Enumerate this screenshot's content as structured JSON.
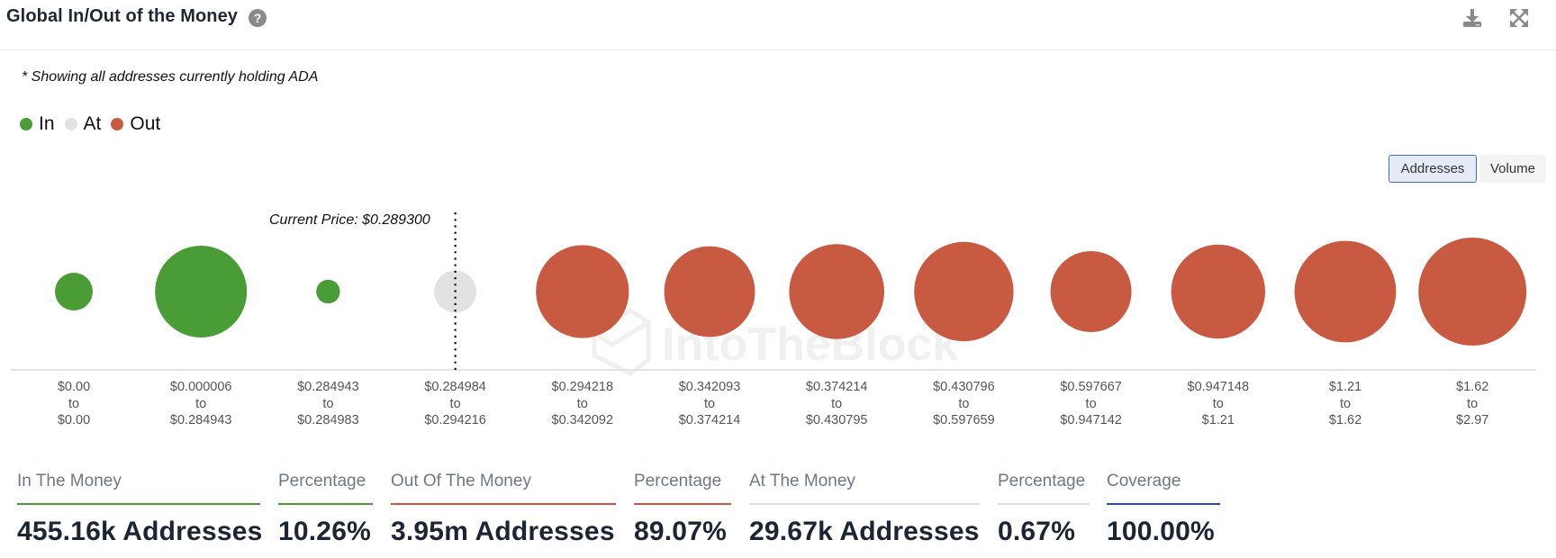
{
  "header": {
    "title": "Global In/Out of the Money",
    "help_icon": "question-circle-icon",
    "download_icon": "download-icon",
    "expand_icon": "expand-arrows-icon"
  },
  "note": "* Showing all addresses currently holding ADA",
  "legend": [
    {
      "label": "In",
      "color": "#4a9c37"
    },
    {
      "label": "At",
      "color": "#e2e2e2"
    },
    {
      "label": "Out",
      "color": "#c95a42"
    }
  ],
  "toggle": {
    "addresses_label": "Addresses",
    "volume_label": "Volume",
    "selected": "Addresses"
  },
  "colors": {
    "in": "#4a9c37",
    "at": "#e2e2e2",
    "out": "#c95a42",
    "coverage": "#2a46d6",
    "at_line": "#dcdcdc",
    "baseline": "#dde3ef"
  },
  "chart_data": {
    "type": "bubble",
    "title": "Global In/Out of the Money",
    "current_price_label": "Current Price: $0.289300",
    "current_price": 0.2893,
    "current_price_bucket_index": 3,
    "watermark": "IntoTheBlock",
    "size_metric": "Addresses",
    "size_note": "relative bubble size (estimated from bubble diameter, largest = 1.0)",
    "buckets": [
      {
        "from": "$0.00",
        "to": "$0.00",
        "status": "in",
        "relative_size": 0.35
      },
      {
        "from": "$0.000006",
        "to": "$0.284943",
        "status": "in",
        "relative_size": 0.85
      },
      {
        "from": "$0.284943",
        "to": "$0.284983",
        "status": "in",
        "relative_size": 0.22
      },
      {
        "from": "$0.284984",
        "to": "$0.294216",
        "status": "at",
        "relative_size": 0.39
      },
      {
        "from": "$0.294218",
        "to": "$0.342092",
        "status": "out",
        "relative_size": 0.86
      },
      {
        "from": "$0.342093",
        "to": "$0.374214",
        "status": "out",
        "relative_size": 0.84
      },
      {
        "from": "$0.374214",
        "to": "$0.430795",
        "status": "out",
        "relative_size": 0.88
      },
      {
        "from": "$0.430796",
        "to": "$0.597659",
        "status": "out",
        "relative_size": 0.92
      },
      {
        "from": "$0.597667",
        "to": "$0.947142",
        "status": "out",
        "relative_size": 0.75
      },
      {
        "from": "$0.947148",
        "to": "$1.21",
        "status": "out",
        "relative_size": 0.87
      },
      {
        "from": "$1.21",
        "to": "$1.62",
        "status": "out",
        "relative_size": 0.94
      },
      {
        "from": "$1.62",
        "to": "$2.97",
        "status": "out",
        "relative_size": 1.0
      }
    ],
    "range_connector": "to"
  },
  "stats": [
    {
      "label": "In The Money",
      "value": "455.16k Addresses",
      "color_key": "in"
    },
    {
      "label": "Percentage",
      "value": "10.26%",
      "color_key": "in"
    },
    {
      "label": "Out Of The Money",
      "value": "3.95m Addresses",
      "color_key": "out"
    },
    {
      "label": "Percentage",
      "value": "89.07%",
      "color_key": "out"
    },
    {
      "label": "At The Money",
      "value": "29.67k Addresses",
      "color_key": "at_line"
    },
    {
      "label": "Percentage",
      "value": "0.67%",
      "color_key": "at_line"
    },
    {
      "label": "Coverage",
      "value": "100.00%",
      "color_key": "coverage"
    }
  ]
}
